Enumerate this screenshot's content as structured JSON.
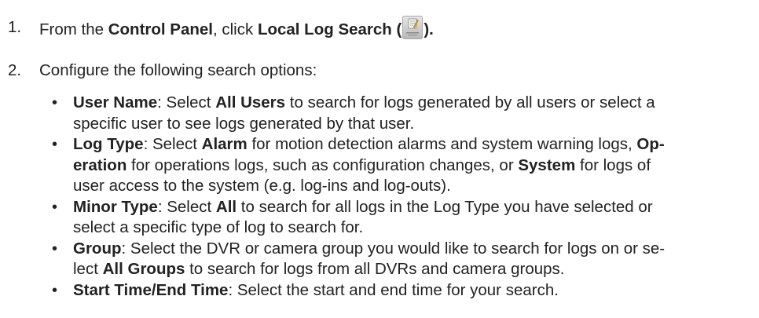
{
  "steps": [
    {
      "number": "1.",
      "text": {
        "from_the": "From the ",
        "control_panel": "Control Panel",
        "comma_click": ", click ",
        "local_log_search": "Local Log Search (",
        "close_paren": ")."
      },
      "icon_name": "local-log-search-icon"
    },
    {
      "number": "2.",
      "text": "Configure the following search options:"
    }
  ],
  "options": [
    {
      "bullet": "•",
      "lines": [
        [
          {
            "b": true,
            "t": "User Name"
          },
          {
            "b": false,
            "t": ": Select "
          },
          {
            "b": true,
            "t": "All Users"
          },
          {
            "b": false,
            "t": " to search for logs generated by all users or select a"
          }
        ],
        [
          {
            "b": false,
            "t": "specific user to see logs generated by that user."
          }
        ]
      ]
    },
    {
      "bullet": "•",
      "lines": [
        [
          {
            "b": true,
            "t": "Log Type"
          },
          {
            "b": false,
            "t": ": Select "
          },
          {
            "b": true,
            "t": "Alarm"
          },
          {
            "b": false,
            "t": " for motion detection alarms and system warning logs, "
          },
          {
            "b": true,
            "t": "Op-"
          }
        ],
        [
          {
            "b": true,
            "t": "eration"
          },
          {
            "b": false,
            "t": " for operations logs, such as configuration changes, or "
          },
          {
            "b": true,
            "t": "System"
          },
          {
            "b": false,
            "t": " for logs of"
          }
        ],
        [
          {
            "b": false,
            "t": "user access to the system (e.g. log-ins and log-outs)."
          }
        ]
      ]
    },
    {
      "bullet": "•",
      "lines": [
        [
          {
            "b": true,
            "t": "Minor Type"
          },
          {
            "b": false,
            "t": ": Select "
          },
          {
            "b": true,
            "t": "All"
          },
          {
            "b": false,
            "t": " to search for all logs in the Log Type you have selected or"
          }
        ],
        [
          {
            "b": false,
            "t": "select a specific type of log to search for."
          }
        ]
      ]
    },
    {
      "bullet": "•",
      "lines": [
        [
          {
            "b": true,
            "t": "Group"
          },
          {
            "b": false,
            "t": ": Select the DVR or camera group you would like to search for logs on or se-"
          }
        ],
        [
          {
            "b": false,
            "t": "lect "
          },
          {
            "b": true,
            "t": "All Groups"
          },
          {
            "b": false,
            "t": " to search for logs from all DVRs and camera groups."
          }
        ]
      ]
    },
    {
      "bullet": "•",
      "lines": [
        [
          {
            "b": true,
            "t": "Start Time/End Time"
          },
          {
            "b": false,
            "t": ": Select the start and end time for your search."
          }
        ]
      ]
    }
  ]
}
